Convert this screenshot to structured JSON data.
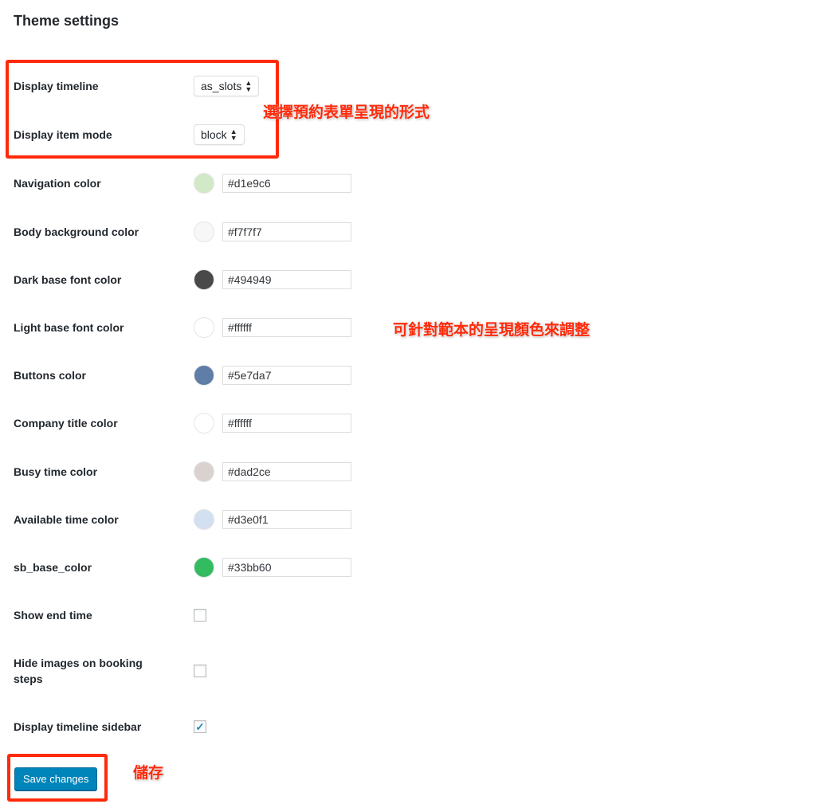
{
  "title": "Theme settings",
  "selects": [
    {
      "label": "Display timeline",
      "value": "as_slots"
    },
    {
      "label": "Display item mode",
      "value": "block"
    }
  ],
  "colors": [
    {
      "label": "Navigation color",
      "value": "#d1e9c6"
    },
    {
      "label": "Body background color",
      "value": "#f7f7f7"
    },
    {
      "label": "Dark base font color",
      "value": "#494949"
    },
    {
      "label": "Light base font color",
      "value": "#ffffff"
    },
    {
      "label": "Buttons color",
      "value": "#5e7da7"
    },
    {
      "label": "Company title color",
      "value": "#ffffff"
    },
    {
      "label": "Busy time color",
      "value": "#dad2ce"
    },
    {
      "label": "Available time color",
      "value": "#d3e0f1"
    },
    {
      "label": "sb_base_color",
      "value": "#33bb60"
    }
  ],
  "checkboxes": [
    {
      "label": "Show end time",
      "checked": false
    },
    {
      "label": "Hide images on booking steps",
      "checked": false
    },
    {
      "label": "Display timeline sidebar",
      "checked": true
    }
  ],
  "save_label": "Save changes",
  "annotations": {
    "select_note": "選擇預約表單呈現的形式",
    "color_note": "可針對範本的呈現顏色來調整",
    "save_note": "儲存"
  },
  "annotation_color": "#ff2a0a",
  "accent": "#0085ba"
}
